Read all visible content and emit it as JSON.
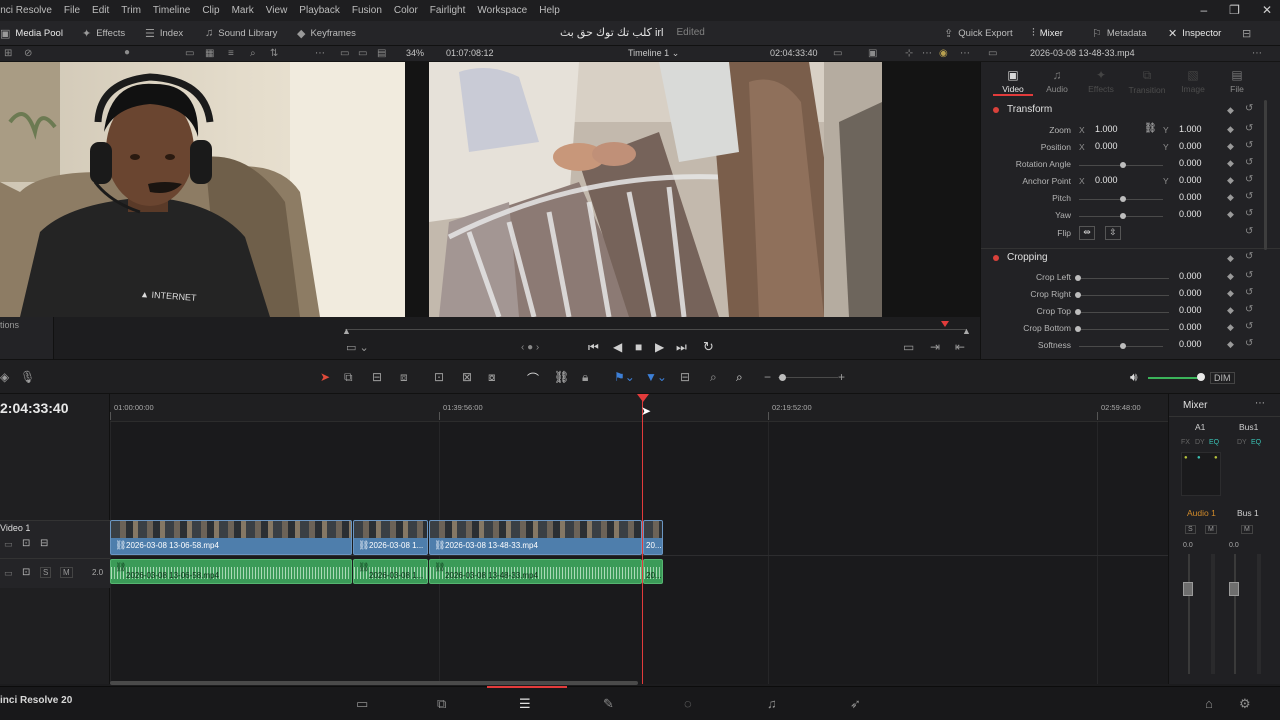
{
  "menu": {
    "app": "inci Resolve",
    "items": [
      "File",
      "Edit",
      "Trim",
      "Timeline",
      "Clip",
      "Mark",
      "View",
      "Playback",
      "Fusion",
      "Color",
      "Fairlight",
      "Workspace",
      "Help"
    ]
  },
  "toolbar": {
    "media_pool": "Media Pool",
    "effects": "Effects",
    "index": "Index",
    "sound_library": "Sound Library",
    "keyframes": "Keyframes",
    "project_title": "كلب تك توك حق بث irl",
    "project_status": "Edited",
    "quick_export": "Quick Export",
    "mixer": "Mixer",
    "metadata": "Metadata",
    "inspector": "Inspector"
  },
  "subbar": {
    "zoom": "34%",
    "source_timecode": "01:07:08:12",
    "timeline_name": "Timeline 1",
    "timeline_timecode": "02:04:33:40",
    "clip_name": "2026-03-08 13-48-33.mp4"
  },
  "left_stub": {
    "label": "tions"
  },
  "inspector": {
    "tabs": [
      "Video",
      "Audio",
      "Effects",
      "Transition",
      "Image",
      "File"
    ],
    "transform": {
      "title": "Transform",
      "zoom": {
        "label": "Zoom",
        "x": "1.000",
        "y": "1.000"
      },
      "position": {
        "label": "Position",
        "x": "0.000",
        "y": "0.000"
      },
      "rotation": {
        "label": "Rotation Angle",
        "value": "0.000"
      },
      "anchor": {
        "label": "Anchor Point",
        "x": "0.000",
        "y": "0.000"
      },
      "pitch": {
        "label": "Pitch",
        "value": "0.000"
      },
      "yaw": {
        "label": "Yaw",
        "value": "0.000"
      },
      "flip": {
        "label": "Flip"
      }
    },
    "cropping": {
      "title": "Cropping",
      "crop_left": {
        "label": "Crop Left",
        "value": "0.000"
      },
      "crop_right": {
        "label": "Crop Right",
        "value": "0.000"
      },
      "crop_top": {
        "label": "Crop Top",
        "value": "0.000"
      },
      "crop_bottom": {
        "label": "Crop Bottom",
        "value": "0.000"
      },
      "softness": {
        "label": "Softness",
        "value": "0.000"
      }
    },
    "axis_x": "X",
    "axis_y": "Y"
  },
  "timeline": {
    "timecode": "2:04:33:40",
    "ruler": [
      "01:00:00:00",
      "01:39:56:00",
      "02:19:52:00",
      "02:59:48:00"
    ],
    "video_track": "Video 1",
    "audio_level": "2.0",
    "dim": "DIM",
    "video_clips": [
      "2026-03-08 13-06-58.mp4",
      "2026-03-08 1...",
      "2026-03-08 13-48-33.mp4",
      "20..."
    ],
    "audio_clips": [
      "2026-03-08 13-06-58.mp4",
      "2026-03-08 1...",
      "2026-03-08 13-48-33.mp4",
      "20..."
    ]
  },
  "mixer": {
    "title": "Mixer",
    "channels": [
      "A1",
      "Bus1"
    ],
    "track_names": [
      "Audio 1",
      "Bus 1"
    ],
    "levels": [
      "0.0",
      "0.0"
    ],
    "fx": "FX",
    "dy": "DY",
    "eq": "EQ"
  },
  "footer": {
    "app_version": "inci Resolve 20"
  },
  "colors": {
    "accent_red": "#e23b3b",
    "video_clip": "#4e7eac",
    "audio_clip": "#3b9b58"
  }
}
